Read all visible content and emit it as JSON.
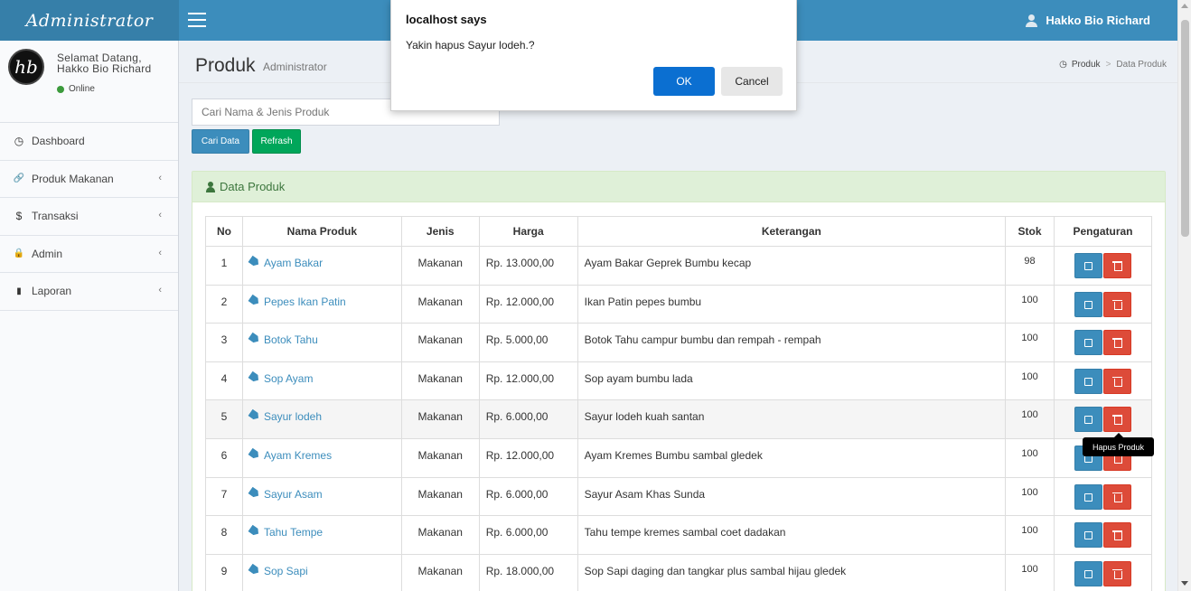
{
  "header": {
    "logo_text": "Administrator",
    "user_name": "Hakko Bio Richard"
  },
  "sidebar": {
    "avatar_text": "hb",
    "welcome_line1": "Selamat Datang,",
    "welcome_line2": "Hakko Bio Richard",
    "status": "Online",
    "items": [
      {
        "label": "Dashboard",
        "icon": "dashboard-icon",
        "glyph": "◷"
      },
      {
        "label": "Produk Makanan",
        "icon": "link-icon",
        "glyph": "🔗"
      },
      {
        "label": "Transaksi",
        "icon": "dollar-icon",
        "glyph": "$"
      },
      {
        "label": "Admin",
        "icon": "lock-icon",
        "glyph": "🔒"
      },
      {
        "label": "Laporan",
        "icon": "file-icon",
        "glyph": "▮"
      }
    ]
  },
  "page": {
    "title": "Produk",
    "subtitle": "Administrator",
    "breadcrumb": [
      "Produk",
      "Data Produk"
    ]
  },
  "search": {
    "placeholder": "Cari Nama & Jenis Produk",
    "search_label": "Cari Data",
    "refresh_label": "Refrash"
  },
  "panel": {
    "title": "Data Produk"
  },
  "table": {
    "headers": [
      "No",
      "Nama Produk",
      "Jenis",
      "Harga",
      "Keterangan",
      "Stok",
      "Pengaturan"
    ],
    "rows": [
      [
        "1",
        "Ayam Bakar",
        "Makanan",
        "Rp. 13.000,00",
        "Ayam Bakar Geprek Bumbu kecap",
        "98"
      ],
      [
        "2",
        "Pepes Ikan Patin",
        "Makanan",
        "Rp. 12.000,00",
        "Ikan Patin pepes bumbu",
        "100"
      ],
      [
        "3",
        "Botok Tahu",
        "Makanan",
        "Rp. 5.000,00",
        "Botok Tahu campur bumbu dan rempah - rempah",
        "100"
      ],
      [
        "4",
        "Sop Ayam",
        "Makanan",
        "Rp. 12.000,00",
        "Sop ayam bumbu lada",
        "100"
      ],
      [
        "5",
        "Sayur lodeh",
        "Makanan",
        "Rp. 6.000,00",
        "Sayur lodeh kuah santan",
        "100"
      ],
      [
        "6",
        "Ayam Kremes",
        "Makanan",
        "Rp. 12.000,00",
        "Ayam Kremes Bumbu sambal gledek",
        "100"
      ],
      [
        "7",
        "Sayur Asam",
        "Makanan",
        "Rp. 6.000,00",
        "Sayur Asam Khas Sunda",
        "100"
      ],
      [
        "8",
        "Tahu Tempe",
        "Makanan",
        "Rp. 6.000,00",
        "Tahu tempe kremes sambal coet dadakan",
        "100"
      ],
      [
        "9",
        "Sop Sapi",
        "Makanan",
        "Rp. 18.000,00",
        "Sop Sapi daging dan tangkar plus sambal hijau gledek",
        "100"
      ]
    ],
    "highlight_row": 4
  },
  "tooltip": {
    "text": "Hapus Produk"
  },
  "dialog": {
    "title": "localhost says",
    "message": "Yakin hapus Sayur lodeh.?",
    "ok_label": "OK",
    "cancel_label": "Cancel"
  },
  "colors": {
    "header": "#3c8dbc",
    "logo": "#367fa9",
    "edit": "#3c8dbc",
    "delete": "#dd4b39",
    "refresh": "#00a65a",
    "panel_heading": "#dff0d8"
  }
}
